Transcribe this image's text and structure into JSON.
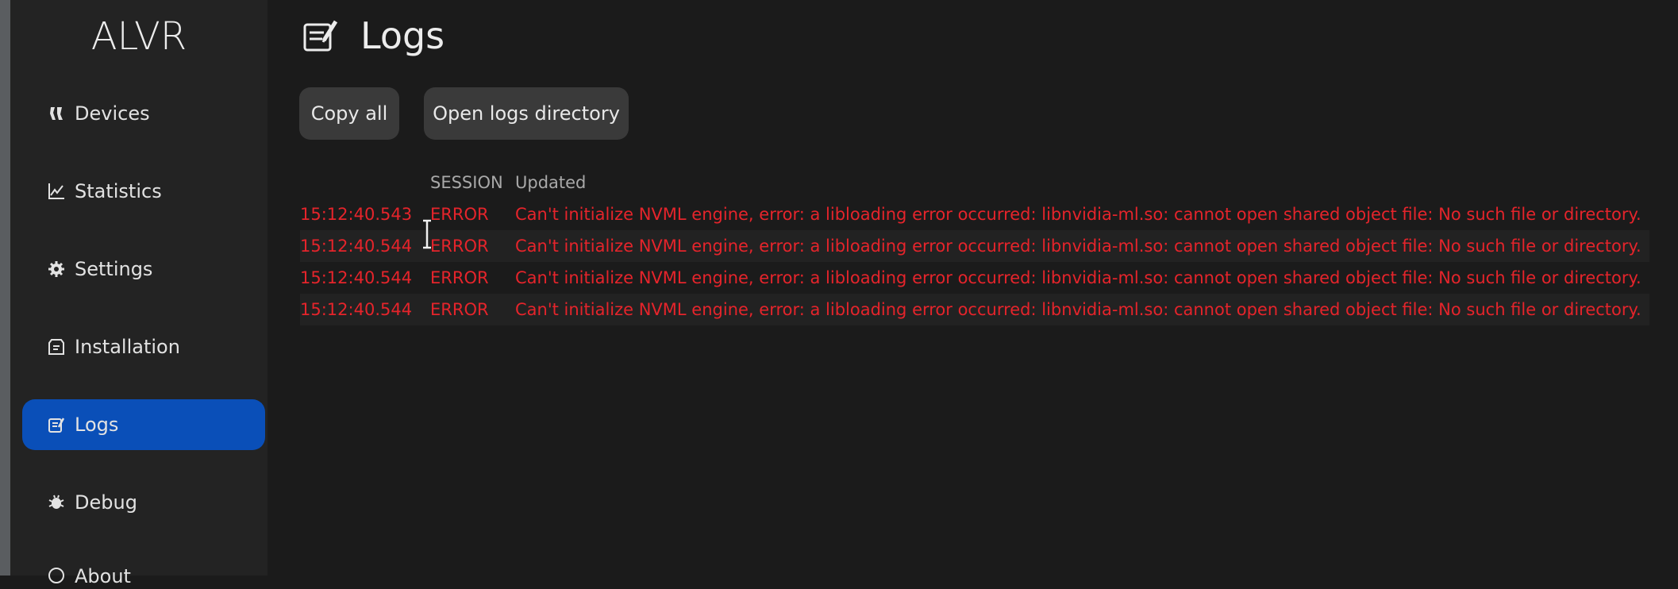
{
  "sidebar": {
    "title": "ALVR",
    "items": [
      {
        "label": "Devices",
        "icon": "devices-icon"
      },
      {
        "label": "Statistics",
        "icon": "chart-icon"
      },
      {
        "label": "Settings",
        "icon": "gear-icon"
      },
      {
        "label": "Installation",
        "icon": "installation-icon"
      },
      {
        "label": "Logs",
        "icon": "logs-icon",
        "active": true
      },
      {
        "label": "Debug",
        "icon": "bug-icon"
      },
      {
        "label": "About",
        "icon": "info-icon"
      }
    ]
  },
  "main": {
    "title": "Logs",
    "buttons": {
      "copy_all": "Copy all",
      "open_logs": "Open logs directory"
    },
    "log_header": {
      "time": "",
      "source": "SESSION",
      "message": "Updated"
    },
    "log_rows": [
      {
        "time": "15:12:40.543",
        "level": "ERROR",
        "message": "Can't initialize NVML engine, error: a libloading error occurred: libnvidia-ml.so: cannot open shared object file: No such file or directory."
      },
      {
        "time": "15:12:40.544",
        "level": "ERROR",
        "message": "Can't initialize NVML engine, error: a libloading error occurred: libnvidia-ml.so: cannot open shared object file: No such file or directory."
      },
      {
        "time": "15:12:40.544",
        "level": "ERROR",
        "message": "Can't initialize NVML engine, error: a libloading error occurred: libnvidia-ml.so: cannot open shared object file: No such file or directory."
      },
      {
        "time": "15:12:40.544",
        "level": "ERROR",
        "message": "Can't initialize NVML engine, error: a libloading error occurred: libnvidia-ml.so: cannot open shared object file: No such file or directory."
      }
    ]
  },
  "colors": {
    "accent": "#0a4fb8",
    "error": "#e5242b",
    "sidebar": "#232323",
    "background": "#1b1b1b"
  }
}
